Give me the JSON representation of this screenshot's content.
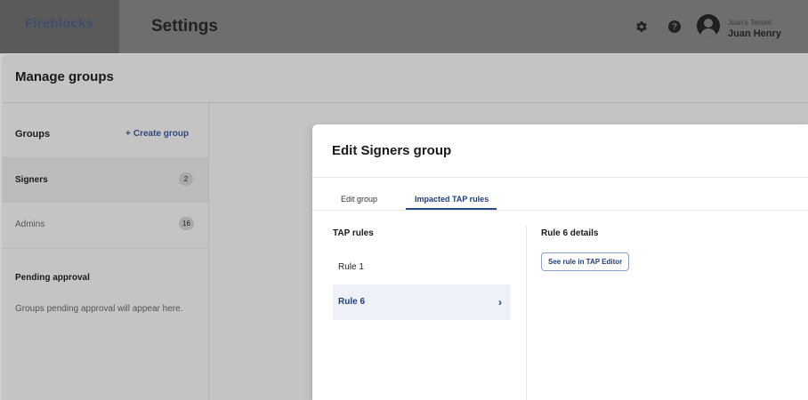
{
  "header": {
    "brand": "Fireblocks",
    "app_title": "Settings",
    "icons": [
      "gear-icon",
      "help-icon",
      "user-avatar-icon"
    ],
    "tenant": "Juan's Tenant",
    "username": "Juan Henry"
  },
  "page": {
    "title": "Manage groups"
  },
  "sidebar": {
    "groups_title": "Groups",
    "create_plus": "+",
    "create_label": "Create group",
    "items": [
      {
        "label": "Signers",
        "count": "2",
        "selected": true
      },
      {
        "label": "Admins",
        "count": "16",
        "selected": false
      }
    ],
    "pending_title": "Pending approval",
    "pending_text": "Groups pending approval will appear here."
  },
  "modal": {
    "title": "Edit Signers group",
    "tabs": [
      {
        "label": "Edit group",
        "active": false
      },
      {
        "label": "Impacted TAP rules",
        "active": true
      }
    ],
    "tap_rules_title": "TAP rules",
    "rules": [
      {
        "label": "Rule 1",
        "selected": false
      },
      {
        "label": "Rule 6",
        "selected": true
      }
    ],
    "chevron": "›",
    "details_title": "Rule 6 details",
    "see_rule_button": "See rule in TAP Editor"
  },
  "colors": {
    "accent": "#1f3f7a",
    "selected_row_bg": "#eef2f8",
    "topbar": "#6e6e6e"
  }
}
